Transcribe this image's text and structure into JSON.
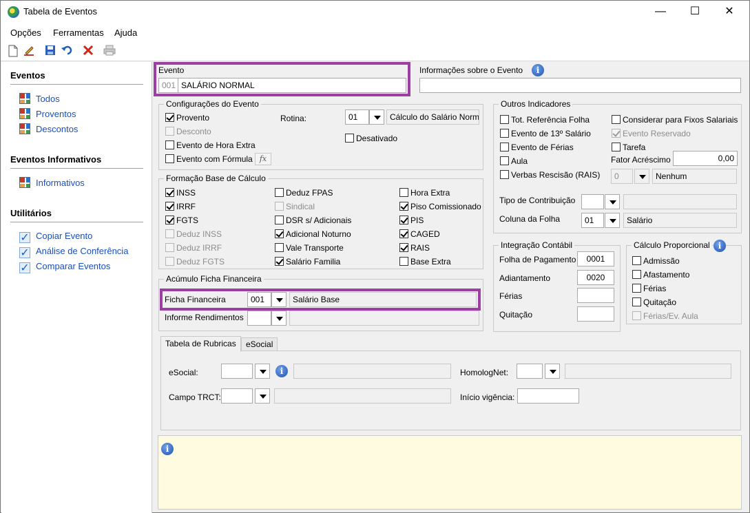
{
  "window": {
    "title": "Tabela de Eventos",
    "minimize": "—",
    "maximize": "☐",
    "close": "✕"
  },
  "menu": [
    "Opções",
    "Ferramentas",
    "Ajuda"
  ],
  "toolbar": {
    "icons": [
      "new-document-icon",
      "edit-pencil-icon",
      "save-icon",
      "undo-icon",
      "delete-icon",
      "print-icon"
    ]
  },
  "sidebar": {
    "sections": [
      {
        "title": "Eventos",
        "items": [
          "Todos",
          "Proventos",
          "Descontos"
        ]
      },
      {
        "title": "Eventos Informativos",
        "items": [
          "Informativos"
        ]
      },
      {
        "title": "Utilitários",
        "items": [
          "Copiar Evento",
          "Análise de Conferência",
          "Comparar Eventos"
        ]
      }
    ]
  },
  "evento": {
    "label": "Evento",
    "code": "001",
    "name": "SALÁRIO NORMAL"
  },
  "info_evento": {
    "label": "Informações sobre o Evento",
    "value": ""
  },
  "config": {
    "title": "Configurações do Evento",
    "proventos": "Provento",
    "desconto": "Desconto",
    "hora_extra": "Evento de Hora Extra",
    "formula": "Evento com Fórmula",
    "fx": "fx",
    "rotina_label": "Rotina:",
    "rotina_code": "01",
    "rotina_desc": "Cálculo do Salário Norma",
    "desativado": "Desativado"
  },
  "formacao": {
    "title": "Formação Base de Cálculo",
    "items": [
      {
        "label": "INSS",
        "checked": true,
        "disabled": false
      },
      {
        "label": "IRRF",
        "checked": true,
        "disabled": false
      },
      {
        "label": "FGTS",
        "checked": true,
        "disabled": false
      },
      {
        "label": "Deduz INSS",
        "checked": false,
        "disabled": true
      },
      {
        "label": "Deduz IRRF",
        "checked": false,
        "disabled": true
      },
      {
        "label": "Deduz FGTS",
        "checked": false,
        "disabled": true
      },
      {
        "label": "Deduz FPAS",
        "checked": false,
        "disabled": false
      },
      {
        "label": "Sindical",
        "checked": false,
        "disabled": true
      },
      {
        "label": "DSR s/ Adicionais",
        "checked": false,
        "disabled": false
      },
      {
        "label": "Adicional Noturno",
        "checked": true,
        "disabled": false
      },
      {
        "label": "Vale Transporte",
        "checked": false,
        "disabled": false
      },
      {
        "label": "Salário Familia",
        "checked": true,
        "disabled": false
      },
      {
        "label": "Hora Extra",
        "checked": false,
        "disabled": false
      },
      {
        "label": "Piso Comissionado",
        "checked": true,
        "disabled": false
      },
      {
        "label": "PIS",
        "checked": true,
        "disabled": false
      },
      {
        "label": "CAGED",
        "checked": true,
        "disabled": false
      },
      {
        "label": "RAIS",
        "checked": true,
        "disabled": false
      },
      {
        "label": "Base Extra",
        "checked": false,
        "disabled": false
      }
    ]
  },
  "acumulo": {
    "title": "Acúmulo Ficha Financeira",
    "ficha_label": "Ficha Financeira",
    "ficha_code": "001",
    "ficha_desc": "Salário Base",
    "informe_label": "Informe Rendimentos",
    "informe_code": "",
    "informe_desc": ""
  },
  "outros": {
    "title": "Outros Indicadores",
    "tot_ref": "Tot. Referência Folha",
    "decimo": "Evento de 13º Salário",
    "ferias": "Evento de Férias",
    "aula": "Aula",
    "verbas": "Verbas Rescisão (RAIS)",
    "fixos": "Considerar para Fixos Salariais",
    "reservado": "Evento Reservado",
    "tarefa": "Tarefa",
    "fator_label": "Fator Acréscimo",
    "fator_value": "0,00",
    "verbas_code": "0",
    "verbas_desc": "Nenhum",
    "tipo_contrib_label": "Tipo de Contribuição",
    "tipo_contrib_code": "",
    "tipo_contrib_desc": "",
    "coluna_label": "Coluna da Folha",
    "coluna_code": "01",
    "coluna_desc": "Salário"
  },
  "integracao": {
    "title": "Integração Contábil",
    "folha_label": "Folha de Pagamento",
    "folha_value": "0001",
    "adiant_label": "Adiantamento",
    "adiant_value": "0020",
    "ferias_label": "Férias",
    "ferias_value": "",
    "quitacao_label": "Quitação",
    "quitacao_value": ""
  },
  "proporcional": {
    "title": "Cálculo Proporcional",
    "admissao": "Admissão",
    "afastamento": "Afastamento",
    "ferias": "Férias",
    "quitacao": "Quitação",
    "ferias_ev_aula": "Férias/Ev. Aula"
  },
  "tabs": [
    "Tabela de Rubricas",
    "eSocial"
  ],
  "esocial": {
    "esocial_label": "eSocial:",
    "homolog_label": "HomologNet:",
    "trct_label": "Campo TRCT:",
    "vigencia_label": "Início vigência:"
  },
  "colors": {
    "highlight": "#9b3fa3",
    "link": "#1a4fbf",
    "notice_bg": "#fffbe0"
  }
}
